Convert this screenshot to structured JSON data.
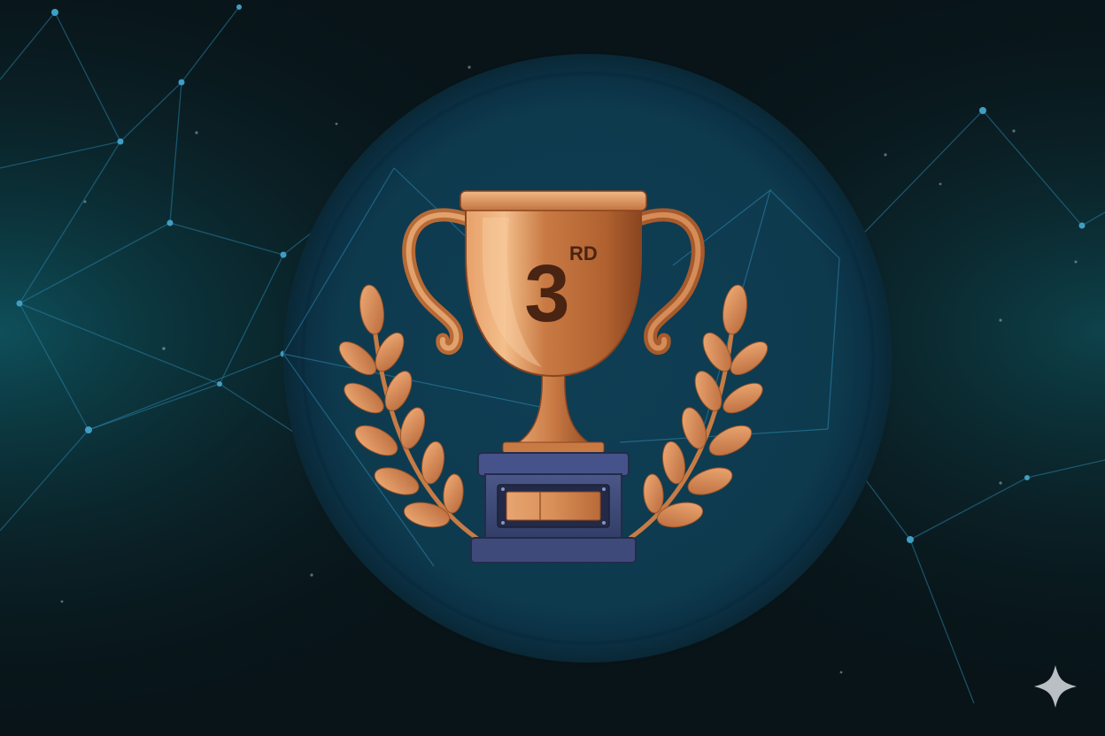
{
  "award": {
    "rank_number": "3",
    "rank_suffix": "RD",
    "tier": "bronze"
  },
  "colors": {
    "background_dark": "#081418",
    "background_teal": "#0f4a55",
    "disc": "#0e3a4e",
    "network_lines": "#2a7fa6",
    "bronze_light": "#f2b07a",
    "bronze_mid": "#c97a44",
    "bronze_dark": "#7a3d1c",
    "rank_text": "#4a2412",
    "pedestal": "#3a4670",
    "pedestal_dark": "#242c4a"
  },
  "icons": {
    "trophy": "trophy-icon",
    "laurel_left": "laurel-left-icon",
    "laurel_right": "laurel-right-icon",
    "watermark": "sparkle-icon"
  }
}
